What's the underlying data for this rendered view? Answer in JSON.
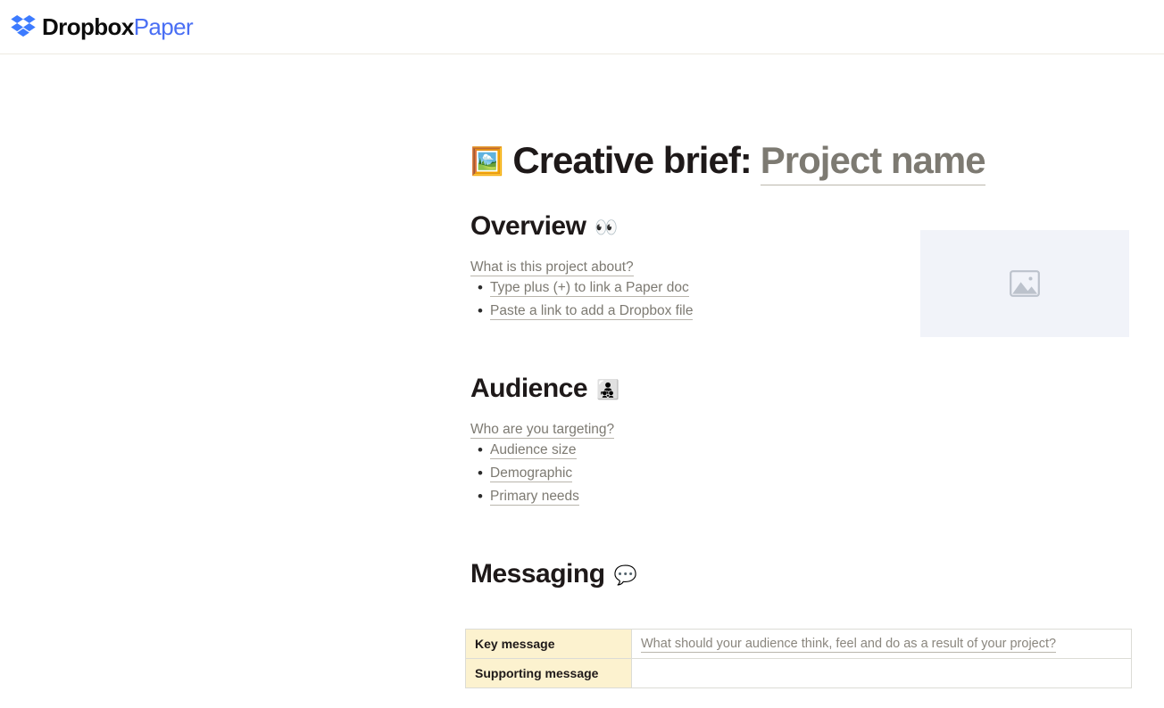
{
  "app": {
    "brand_primary": "Dropbox",
    "brand_secondary": "Paper",
    "logo_icon": "dropbox-logo-icon",
    "brand_color": "#4a6ff4"
  },
  "document": {
    "title_emoji": "🖼️",
    "title_static": "Creative brief:",
    "title_placeholder": "Project name",
    "sections": {
      "overview": {
        "heading": "Overview",
        "emoji": "👀",
        "question": "What is this project about?",
        "bullets": [
          "Type plus (+) to link a Paper doc",
          "Paste a link to add a Dropbox file"
        ]
      },
      "audience": {
        "heading": "Audience",
        "emoji": "👨‍👧‍👦",
        "question": "Who are you targeting?",
        "bullets": [
          "Audience size",
          "Demographic",
          "Primary needs"
        ]
      },
      "messaging": {
        "heading": "Messaging",
        "emoji": "💬",
        "table": {
          "rows": [
            {
              "label": "Key message",
              "value": "What should your audience think, feel and do as a result of your project?"
            },
            {
              "label": "Supporting message",
              "value": ""
            }
          ]
        }
      }
    },
    "image_placeholder": {
      "icon": "image-placeholder-icon",
      "background_color": "#f1f3f9",
      "icon_color": "#bcc2cc"
    }
  }
}
